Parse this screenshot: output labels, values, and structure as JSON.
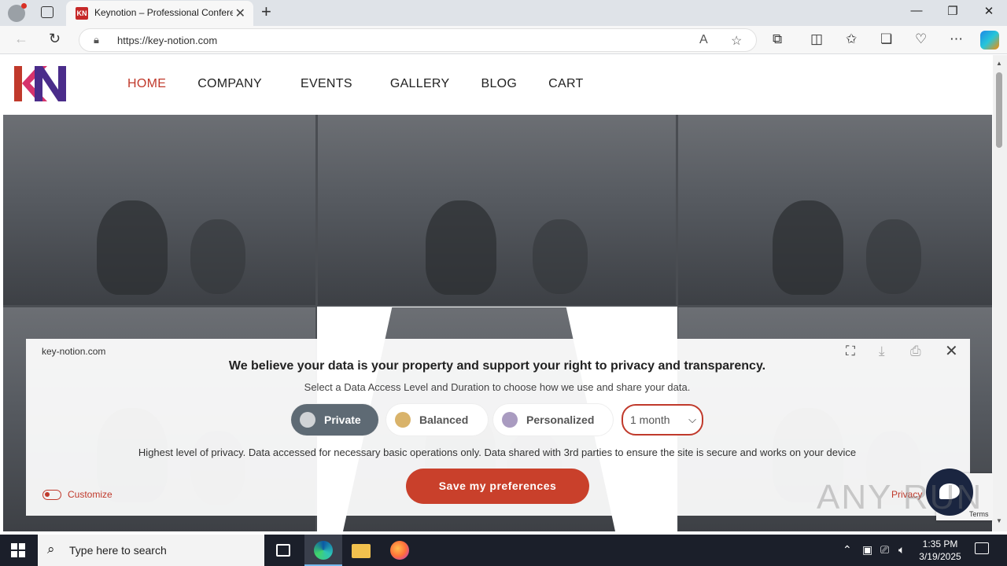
{
  "browser": {
    "tab_title": "Keynotion – Professional Conferences",
    "tab_favicon": "KN",
    "url": "https://key-notion.com",
    "icons": [
      "profile-icon",
      "tab-actions-icon",
      "close-icon",
      "new-tab-icon",
      "minimize-icon",
      "maximize-icon",
      "back-icon",
      "refresh-icon",
      "lock-icon",
      "read-aloud-icon",
      "favorite-icon",
      "extensions-icon",
      "split-screen-icon",
      "favorites-icon",
      "collections-icon",
      "browser-essentials-icon",
      "more-icon",
      "copilot-icon"
    ]
  },
  "site": {
    "nav": [
      "HOME",
      "COMPANY",
      "EVENTS",
      "GALLERY",
      "BLOG",
      "CART"
    ],
    "active_nav": "HOME",
    "brand_colors": {
      "red": "#c0392b",
      "purple": "#4a2c8a"
    }
  },
  "consent": {
    "domain": "key-notion.com",
    "title": "We believe your data is your property and support your right to privacy and transparency.",
    "subtitle": "Select a Data Access Level and Duration to choose how we use and share your data.",
    "levels": [
      {
        "label": "Private",
        "dot_color": "#d0d3d6",
        "selected": true
      },
      {
        "label": "Balanced",
        "dot_color": "#d9b36a",
        "selected": false
      },
      {
        "label": "Personalized",
        "dot_color": "#a99bc0",
        "selected": false
      }
    ],
    "duration": "1 month",
    "description": "Highest level of privacy. Data accessed for necessary basic operations only. Data shared with 3rd parties to ensure the site is secure and works on your device",
    "save_label": "Save my preferences",
    "customize_label": "Customize",
    "privacy_label": "Privacy",
    "recaptcha_terms": "Terms",
    "icons": [
      "fullscreen-icon",
      "download-icon",
      "print-icon",
      "close-icon"
    ]
  },
  "watermark": "ANY RUN",
  "taskbar": {
    "search_placeholder": "Type here to search",
    "time": "1:35 PM",
    "date": "3/19/2025"
  }
}
